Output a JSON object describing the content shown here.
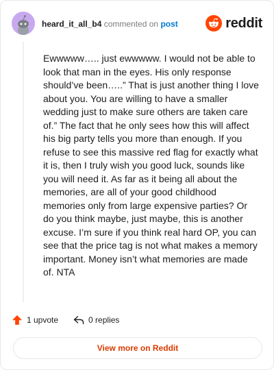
{
  "comment": {
    "author": "heard_it_all_b4",
    "commented_on_text": "commented on",
    "post_link_text": "post",
    "body": "Ewwwww….. just ewwwww. I would not be able to look that man in the eyes. His only response should’ve been…..” That is just another thing I love about you. You are willing to have a smaller wedding just to make sure others are taken care of.” The fact that he only sees how this will affect his big party tells you more than enough. If you refuse to see this massive red flag for exactly what it is, then I truly wish you good luck, sounds like you will need it. As far as it being all about the memories, are all of your good childhood memories only from large expensive parties? Or do you think maybe, just maybe, this is another excuse. I’m sure if you think real hard OP, you can see that the price tag is not what makes a memory important. Money isn’t what memories are made of. NTA",
    "upvote_text": "1 upvote",
    "replies_text": "0 replies"
  },
  "brand": {
    "name": "reddit",
    "accent_color": "#ff4500"
  },
  "footer": {
    "view_more_label": "View more on Reddit"
  },
  "icons": {
    "avatar": "snoo-avatar-icon",
    "logo": "reddit-logo-icon",
    "upvote": "upvote-arrow-icon",
    "reply": "reply-arrow-icon"
  }
}
